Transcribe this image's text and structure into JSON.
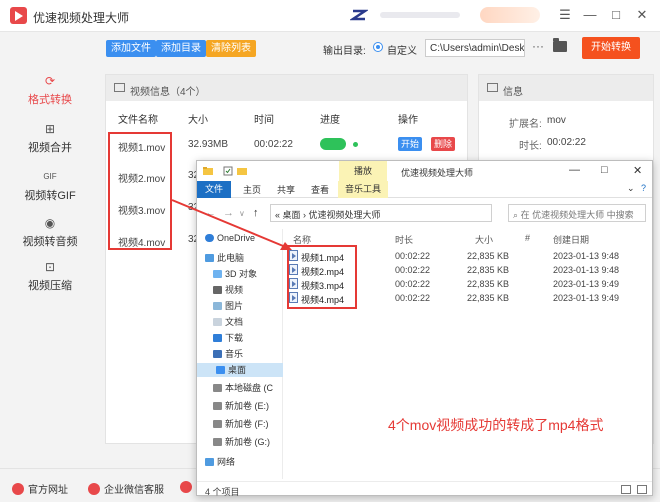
{
  "app": {
    "title": "优速视频处理大师"
  },
  "toolbar": {
    "add_file": "添加文件",
    "add_dir": "添加目录",
    "clear_list": "清除列表",
    "output_label": "输出目录:",
    "custom_label": "自定义",
    "output_path": "C:\\Users\\admin\\Deskto",
    "browse": "···",
    "start_all": "开始转换"
  },
  "sidebar": {
    "items": [
      {
        "label": "格式转换",
        "icon": "refresh-icon"
      },
      {
        "label": "视频合并",
        "icon": "merge-icon"
      },
      {
        "label": "视频转GIF",
        "icon": "gif-icon"
      },
      {
        "label": "视频转音频",
        "icon": "audio-icon"
      },
      {
        "label": "视频压缩",
        "icon": "compress-icon"
      }
    ]
  },
  "video_panel": {
    "header": "视频信息（4个）",
    "columns": [
      "文件名称",
      "大小",
      "时间",
      "进度",
      "操作"
    ],
    "rows": [
      {
        "name": "视频1.mov",
        "size": "32.93MB",
        "time": "00:02:22"
      },
      {
        "name": "视频2.mov",
        "size": "32",
        "time": ""
      },
      {
        "name": "视频3.mov",
        "size": "32",
        "time": ""
      },
      {
        "name": "视频4.mov",
        "size": "32",
        "time": ""
      }
    ],
    "start_label": "开始",
    "delete_label": "删除"
  },
  "info_panel": {
    "header": "信息",
    "ext_label": "扩展名:",
    "ext_value": "mov",
    "duration_label": "时长:",
    "duration_value": "00:02:22"
  },
  "bottom": {
    "website": "官方网址",
    "wechat": "企业微信客服"
  },
  "explorer": {
    "title": "优速视频处理大师",
    "play_tab": "播放",
    "ribbon": [
      "文件",
      "主页",
      "共享",
      "查看",
      "音乐工具"
    ],
    "address": "桌面  ›  优速视频处理大师",
    "address_prefix": "«",
    "search_placeholder": "在 优速视频处理大师 中搜索",
    "nav": [
      "OneDrive",
      "此电脑",
      "3D 对象",
      "视频",
      "图片",
      "文档",
      "下载",
      "音乐",
      "桌面",
      "本地磁盘 (C",
      "新加卷 (E:)",
      "新加卷 (F:)",
      "新加卷 (G:)",
      "网络"
    ],
    "columns": [
      "名称",
      "时长",
      "大小",
      "#",
      "创建日期"
    ],
    "files": [
      {
        "name": "视频1.mp4",
        "duration": "00:02:22",
        "size": "22,835 KB",
        "date": "2023-01-13 9:48"
      },
      {
        "name": "视频2.mp4",
        "duration": "00:02:22",
        "size": "22,835 KB",
        "date": "2023-01-13 9:48"
      },
      {
        "name": "视频3.mp4",
        "duration": "00:02:22",
        "size": "22,835 KB",
        "date": "2023-01-13 9:49"
      },
      {
        "name": "视频4.mp4",
        "duration": "00:02:22",
        "size": "22,835 KB",
        "date": "2023-01-13 9:49"
      }
    ],
    "status": "4 个项目"
  },
  "annotation": "4个mov视频成功的转成了mp4格式",
  "colors": {
    "accent": "#e8484a",
    "primary_blue": "#3b8ff0",
    "annotation_red": "#e53935",
    "start_orange": "#f5511e"
  }
}
